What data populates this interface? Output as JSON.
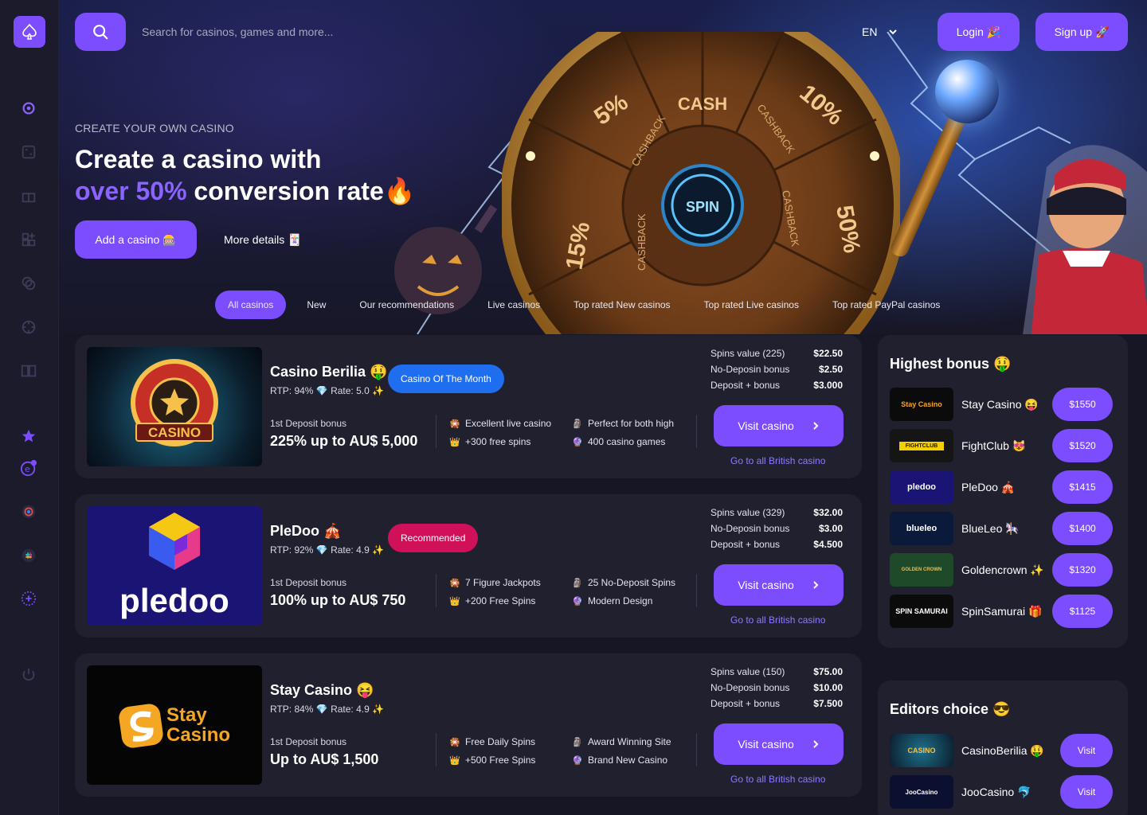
{
  "topbar": {
    "search_placeholder": "Search for casinos, games and more...",
    "lang": "EN",
    "login_label": "Login 🎉",
    "signup_label": "Sign up 🚀"
  },
  "hero": {
    "kicker": "CREATE YOUR OWN CASINO",
    "title_line1": "Create a casino with",
    "title_accent": "over 50%",
    "title_rest": " conversion rate🔥",
    "add_button": "Add a casino 🎰",
    "more_button": "More details 🃏",
    "wheel": {
      "cash": "CASH",
      "spin": "SPIN",
      "cashback": "CASHBACK",
      "pct_5": "5%",
      "pct_10": "10%",
      "pct_15": "15%",
      "pct_50": "50%"
    }
  },
  "tabs": [
    {
      "label": "All casinos",
      "active": true
    },
    {
      "label": "New"
    },
    {
      "label": "Our recommendations"
    },
    {
      "label": "Live casinos"
    },
    {
      "label": "Top rated New casinos"
    },
    {
      "label": "Top rated Live casinos"
    },
    {
      "label": "Top rated PayPal casinos"
    }
  ],
  "casinos": [
    {
      "name": "Casino Berilia 🤑",
      "meta": "RTP: 94% 💎 Rate: 5.0 ✨",
      "badge": "Casino Of The Month",
      "badge_color": "#1f6ef0",
      "thumb_text": "CASINO",
      "dep_label": "1st Deposit bonus",
      "dep_value": "225% up to AU$ 5,000",
      "features": [
        "Excellent live casino",
        "+300 free spins",
        "Perfect for both high",
        "400 casino games"
      ],
      "specs": [
        [
          "Spins value (225)",
          "$22.50"
        ],
        [
          "No-Deposin bonus",
          "$2.50"
        ],
        [
          "Deposit + bonus",
          "$3.000"
        ]
      ],
      "visit": "Visit casino",
      "goto": "Go to all British casino"
    },
    {
      "name": "PleDoo 🎪",
      "meta": "RTP: 92% 💎 Rate: 4.9 ✨",
      "badge": "Recommended",
      "badge_color": "#d1105a",
      "thumb_text": "pledoo",
      "dep_label": "1st Deposit bonus",
      "dep_value": "100% up to AU$ 750",
      "features": [
        "7 Figure Jackpots",
        "+200 Free Spins",
        "25 No-Deposit Spins",
        "Modern Design"
      ],
      "specs": [
        [
          "Spins value (329)",
          "$32.00"
        ],
        [
          "No-Deposin bonus",
          "$3.00"
        ],
        [
          "Deposit + bonus",
          "$4.500"
        ]
      ],
      "visit": "Visit casino",
      "goto": "Go to all British casino"
    },
    {
      "name": "Stay Casino 😝",
      "meta": "RTP: 84% 💎 Rate: 4.9 ✨",
      "badge": "",
      "badge_color": "",
      "thumb_text": "Stay Casino",
      "dep_label": "1st Deposit bonus",
      "dep_value": "Up to AU$ 1,500",
      "features": [
        "Free Daily Spins",
        "+500 Free Spins",
        "Award Winning Site",
        "Brand New Casino"
      ],
      "specs": [
        [
          "Spins value (150)",
          "$75.00"
        ],
        [
          "No-Deposin bonus",
          "$10.00"
        ],
        [
          "Deposit + bonus",
          "$7.500"
        ]
      ],
      "visit": "Visit casino",
      "goto": "Go to all British casino"
    }
  ],
  "highest_bonus": {
    "title": "Highest bonus 🤑",
    "items": [
      {
        "name": "Stay Casino 😝",
        "logo": "Stay Casino",
        "value": "$1550"
      },
      {
        "name": "FightClub 😻",
        "logo": "FIGHTCLUB",
        "value": "$1520"
      },
      {
        "name": "PleDoo 🎪",
        "logo": "pledoo",
        "value": "$1415"
      },
      {
        "name": "BlueLeo 🎠",
        "logo": "blueleo",
        "value": "$1400"
      },
      {
        "name": "Goldencrown ✨",
        "logo": "GOLDEN CROWN",
        "value": "$1320"
      },
      {
        "name": "SpinSamurai 🎁",
        "logo": "SPIN SAMURAI",
        "value": "$1125"
      }
    ]
  },
  "editors_choice": {
    "title": "Editors choice 😎",
    "items": [
      {
        "name": "CasinoBerilia 🤑",
        "logo": "CASINO",
        "button": "Visit"
      },
      {
        "name": "JooCasino 🐬",
        "logo": "JooCasino",
        "button": "Visit"
      }
    ]
  }
}
